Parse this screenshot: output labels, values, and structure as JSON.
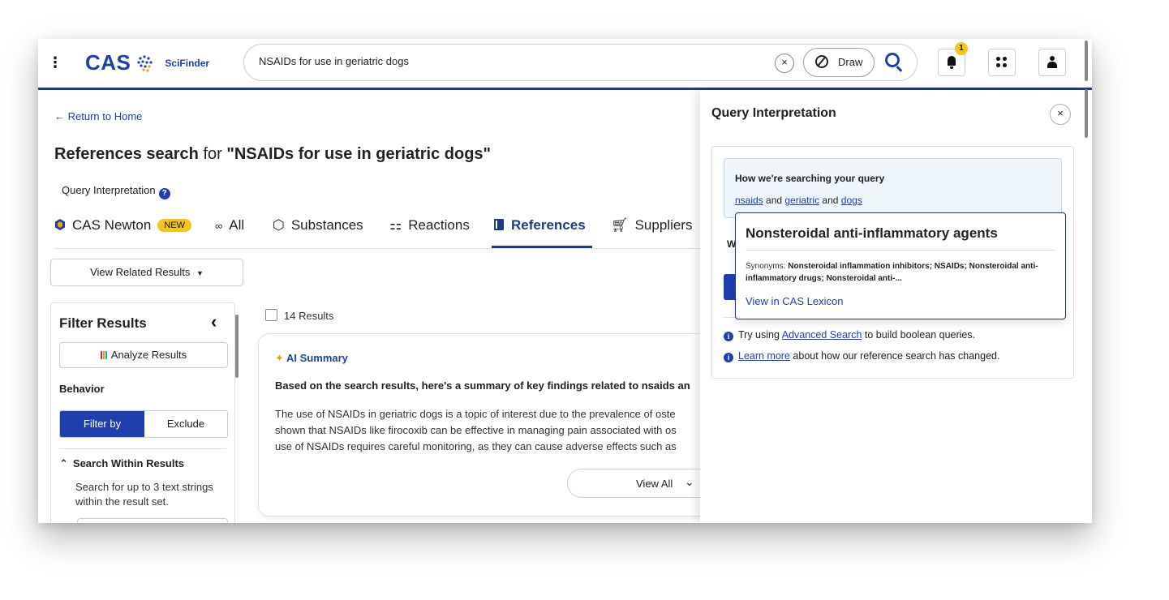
{
  "header": {
    "logo_text": "CAS",
    "product": "SciFinder",
    "search_value": "NSAIDs for use in geriatric dogs",
    "clear_label": "×",
    "draw_label": "Draw",
    "notification_count": "1"
  },
  "page": {
    "return_link": "Return to Home",
    "title_prefix": "References search",
    "title_mid": " for ",
    "title_query": "\"NSAIDs for use in geriatric dogs\"",
    "query_interpretation": "Query Interpretation"
  },
  "tabs": [
    {
      "label": "CAS Newton",
      "badge": "NEW",
      "icon": "cas-newton-icon"
    },
    {
      "label": "All",
      "icon": "all-icon"
    },
    {
      "label": "Substances",
      "icon": "substances-icon"
    },
    {
      "label": "Reactions",
      "icon": "reactions-icon"
    },
    {
      "label": "References",
      "icon": "references-icon",
      "active": true
    },
    {
      "label": "Suppliers",
      "icon": "cart-icon"
    }
  ],
  "related_button": "View Related Results",
  "filter": {
    "title": "Filter Results",
    "analyze_label": "Analyze Results",
    "behavior_label": "Behavior",
    "filter_by": "Filter by",
    "exclude": "Exclude",
    "search_within": "Search Within Results",
    "search_within_desc": "Search for up to 3 text strings within the result set."
  },
  "results": {
    "count_label": "14 Results"
  },
  "ai_summary": {
    "label": "AI Summary",
    "heading": "Based on the search results, here's a summary of key findings related to nsaids an",
    "body_lines": [
      "The use of NSAIDs in geriatric dogs is a topic of interest due to the prevalence of oste",
      "shown that NSAIDs like firocoxib can be effective in managing pain associated with os",
      "use of NSAIDs requires careful monitoring, as they can cause adverse effects such as "
    ],
    "view_all": "View All"
  },
  "panel": {
    "title": "Query Interpretation",
    "close": "×",
    "how_title": "How we're searching your query",
    "term1": "nsaids",
    "and1": " and ",
    "term2": "geriatric",
    "and2": " and ",
    "term3": "dogs",
    "hidden_letter": "W",
    "tip1_pre": "Try using ",
    "tip1_link": "Advanced Search",
    "tip1_post": " to build boolean queries.",
    "tip2_link": "Learn more",
    "tip2_post": " about how our reference search has changed."
  },
  "popover": {
    "title": "Nonsteroidal anti-inflammatory agents",
    "syn_label": "Synonyms: ",
    "synonyms": "Nonsteroidal inflammation inhibitors; NSAIDs; Nonsteroidal anti-inflammatory drugs; Nonsteroidal anti-...",
    "link": "View in CAS Lexicon"
  },
  "colors": {
    "brand": "#1e40af",
    "accent": "#f5c518"
  }
}
